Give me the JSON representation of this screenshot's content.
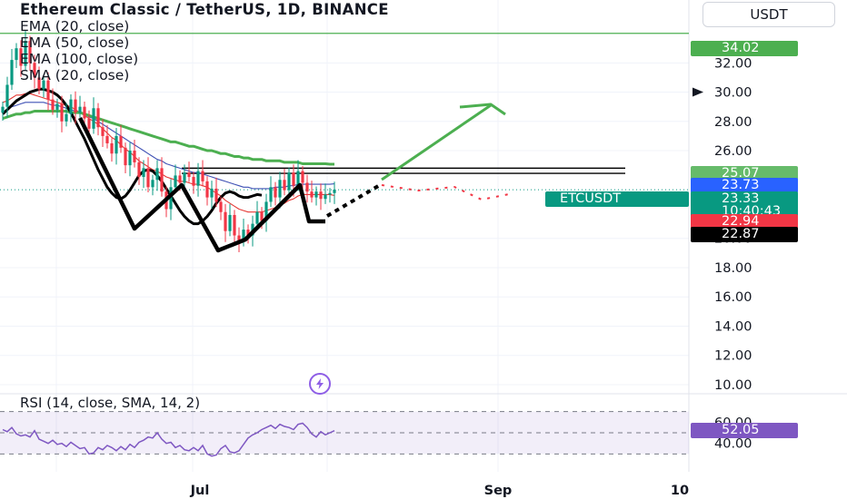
{
  "header": {
    "title": "Ethereum Classic / TetherUS, 1D, BINANCE",
    "indicators": [
      "EMA (20, close)",
      "EMA (50, close)",
      "EMA (100, close)",
      "SMA (20, close)"
    ],
    "currency": "USDT"
  },
  "rsi": {
    "label": "RSI (14, close, SMA, 14, 2)",
    "value_label": "52.05",
    "ylim": [
      20,
      80
    ],
    "ticks": [
      60,
      40
    ],
    "band": [
      30,
      70
    ],
    "series": [
      53,
      51,
      55,
      49,
      47,
      48,
      46,
      52,
      44,
      42,
      40,
      43,
      39,
      40,
      37,
      41,
      38,
      35,
      36,
      30,
      31,
      36,
      34,
      38,
      36,
      33,
      37,
      34,
      39,
      36,
      41,
      43,
      46,
      45,
      50,
      44,
      40,
      41,
      36,
      38,
      34,
      33,
      36,
      33,
      38,
      30,
      28,
      29,
      35,
      38,
      32,
      31,
      33,
      39,
      45,
      48,
      50,
      53,
      55,
      57,
      54,
      58,
      56,
      55,
      53,
      58,
      59,
      55,
      49,
      46,
      51,
      48,
      50,
      52
    ]
  },
  "labels": {
    "symbol_tag": "ETCUSDT",
    "countdown": "10:40:43",
    "tags": [
      {
        "value": "34.02",
        "color": "#4caf50"
      },
      {
        "value": "25.07",
        "color": "#66bb6a"
      },
      {
        "value": "23.73",
        "color": "#2962ff"
      },
      {
        "value": "23.33",
        "color": "#089981"
      },
      {
        "value": "22.94",
        "color": "#f23645"
      },
      {
        "value": "22.87",
        "color": "#000000"
      }
    ]
  },
  "chart_data": {
    "type": "candlestick",
    "title": "Ethereum Classic / TetherUS, 1D, BINANCE",
    "ylim": [
      9.5,
      36.3
    ],
    "y_ticks": [
      32,
      30,
      28,
      26,
      20,
      18,
      16,
      14,
      12,
      10
    ],
    "x_ticks": [
      "Jul",
      "Sep",
      "10"
    ],
    "last_price": 23.33,
    "horizontal_lines": [
      34.02,
      24.8,
      24.45
    ],
    "closes": [
      29.0,
      30.5,
      32.2,
      33.0,
      31.8,
      33.5,
      32.0,
      31.0,
      30.2,
      30.8,
      29.5,
      28.8,
      29.2,
      28.0,
      28.5,
      29.5,
      28.6,
      29.0,
      28.2,
      27.5,
      28.9,
      27.6,
      27.0,
      26.5,
      25.8,
      27.0,
      26.2,
      25.0,
      26.0,
      25.2,
      24.2,
      24.8,
      23.5,
      24.0,
      24.8,
      23.2,
      22.0,
      23.5,
      24.3,
      23.8,
      24.5,
      24.2,
      23.6,
      24.6,
      23.9,
      22.8,
      23.4,
      22.5,
      21.8,
      20.5,
      21.6,
      20.2,
      19.8,
      20.6,
      20.2,
      21.0,
      21.8,
      21.2,
      22.5,
      23.5,
      22.8,
      24.0,
      23.3,
      24.5,
      23.6,
      24.6,
      23.8,
      23.2,
      22.8,
      23.2,
      22.7,
      23.0,
      23.1,
      23.33
    ],
    "series": [
      {
        "name": "EMA (20, close)",
        "color": "#e53935",
        "values": [
          29.3,
          29.4,
          29.6,
          29.8,
          29.8,
          29.9,
          29.9,
          29.8,
          29.7,
          29.6,
          29.5,
          29.4,
          29.3,
          29.2,
          29.1,
          29.0,
          28.8,
          28.6,
          28.4,
          28.2,
          28.0,
          27.8,
          27.5,
          27.2,
          26.9,
          26.7,
          26.4,
          26.1,
          25.9,
          25.6,
          25.3,
          25.1,
          24.9,
          24.7,
          24.6,
          24.4,
          24.2,
          24.1,
          24.0,
          23.9,
          23.9,
          23.8,
          23.7,
          23.7,
          23.6,
          23.5,
          23.3,
          23.1,
          22.9,
          22.6,
          22.4,
          22.2,
          22.0,
          21.9,
          21.8,
          21.8,
          21.8,
          21.8,
          21.9,
          22.0,
          22.1,
          22.3,
          22.4,
          22.6,
          22.7,
          22.9,
          23.0,
          23.0,
          23.0,
          23.0,
          23.0,
          23.0,
          23.0,
          22.94
        ]
      },
      {
        "name": "EMA (50, close)",
        "color": "#3f51b5",
        "values": [
          28.6,
          28.8,
          29.0,
          29.1,
          29.2,
          29.3,
          29.3,
          29.3,
          29.3,
          29.3,
          29.2,
          29.1,
          29.1,
          29.0,
          28.9,
          28.8,
          28.7,
          28.6,
          28.5,
          28.3,
          28.2,
          28.0,
          27.8,
          27.6,
          27.4,
          27.2,
          27.0,
          26.8,
          26.6,
          26.4,
          26.2,
          26.0,
          25.8,
          25.6,
          25.4,
          25.3,
          25.1,
          25.0,
          24.9,
          24.8,
          24.7,
          24.6,
          24.5,
          24.5,
          24.4,
          24.3,
          24.2,
          24.1,
          24.0,
          23.9,
          23.8,
          23.7,
          23.6,
          23.5,
          23.5,
          23.4,
          23.4,
          23.4,
          23.4,
          23.4,
          23.5,
          23.5,
          23.5,
          23.6,
          23.6,
          23.7,
          23.7,
          23.7,
          23.7,
          23.7,
          23.7,
          23.7,
          23.7,
          23.73
        ]
      },
      {
        "name": "EMA (100, close)",
        "color": "#4caf50",
        "values": [
          28.2,
          28.3,
          28.4,
          28.5,
          28.5,
          28.6,
          28.6,
          28.7,
          28.7,
          28.7,
          28.7,
          28.7,
          28.7,
          28.7,
          28.7,
          28.6,
          28.6,
          28.6,
          28.5,
          28.4,
          28.3,
          28.2,
          28.1,
          28.0,
          27.9,
          27.8,
          27.7,
          27.6,
          27.5,
          27.4,
          27.3,
          27.2,
          27.1,
          27.0,
          26.9,
          26.8,
          26.7,
          26.6,
          26.6,
          26.5,
          26.4,
          26.3,
          26.3,
          26.2,
          26.1,
          26.0,
          26.0,
          25.9,
          25.8,
          25.8,
          25.7,
          25.6,
          25.6,
          25.5,
          25.5,
          25.4,
          25.4,
          25.4,
          25.3,
          25.3,
          25.3,
          25.3,
          25.2,
          25.2,
          25.2,
          25.2,
          25.1,
          25.1,
          25.1,
          25.1,
          25.1,
          25.1,
          25.07,
          25.07
        ]
      },
      {
        "name": "SMA (20, close)",
        "color": "#000000",
        "values": [
          28.5,
          28.8,
          29.1,
          29.4,
          29.6,
          29.8,
          30.0,
          30.1,
          30.2,
          30.2,
          30.1,
          30.0,
          29.8,
          29.5,
          29.1,
          28.6,
          28.0,
          27.4,
          26.8,
          26.1,
          25.4,
          24.7,
          24.1,
          23.5,
          23.1,
          22.8,
          22.7,
          22.9,
          23.3,
          23.8,
          24.3,
          24.6,
          24.7,
          24.6,
          24.3,
          23.9,
          23.4,
          22.9,
          22.4,
          21.9,
          21.5,
          21.2,
          21.0,
          21.0,
          21.2,
          21.5,
          21.9,
          22.4,
          22.8,
          23.1,
          23.2,
          23.1,
          22.9,
          22.8,
          22.8,
          22.9,
          23.0,
          22.95
        ]
      }
    ]
  }
}
